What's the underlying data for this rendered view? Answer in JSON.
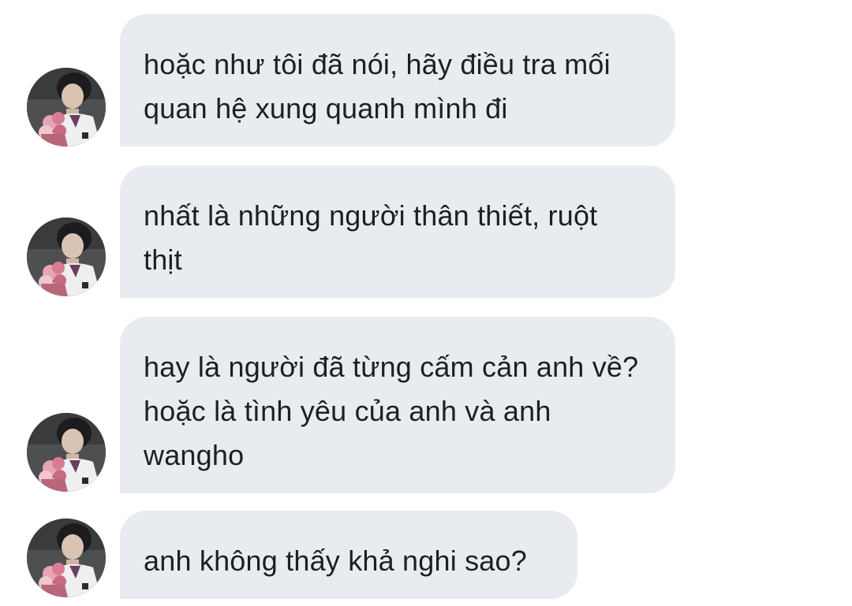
{
  "conversation": {
    "messages": [
      {
        "lines": [
          "hoặc như tôi đã nói, hãy điều tra mối",
          "quan hệ xung quanh mình đi"
        ]
      },
      {
        "lines": [
          "nhất là những người thân thiết, ruột",
          "thịt"
        ]
      },
      {
        "lines": [
          "hay là người đã từng cấm cản anh về?",
          "hoặc là tình yêu của anh và anh",
          "wangho"
        ]
      },
      {
        "lines": [
          "anh không thấy khả nghi sao?"
        ]
      }
    ]
  },
  "colors": {
    "bubble_bg": "#e8ecf1",
    "text": "#1f1f22",
    "page_bg": "#ffffff"
  },
  "icons": {
    "avatar": "profile-photo-avatar"
  }
}
